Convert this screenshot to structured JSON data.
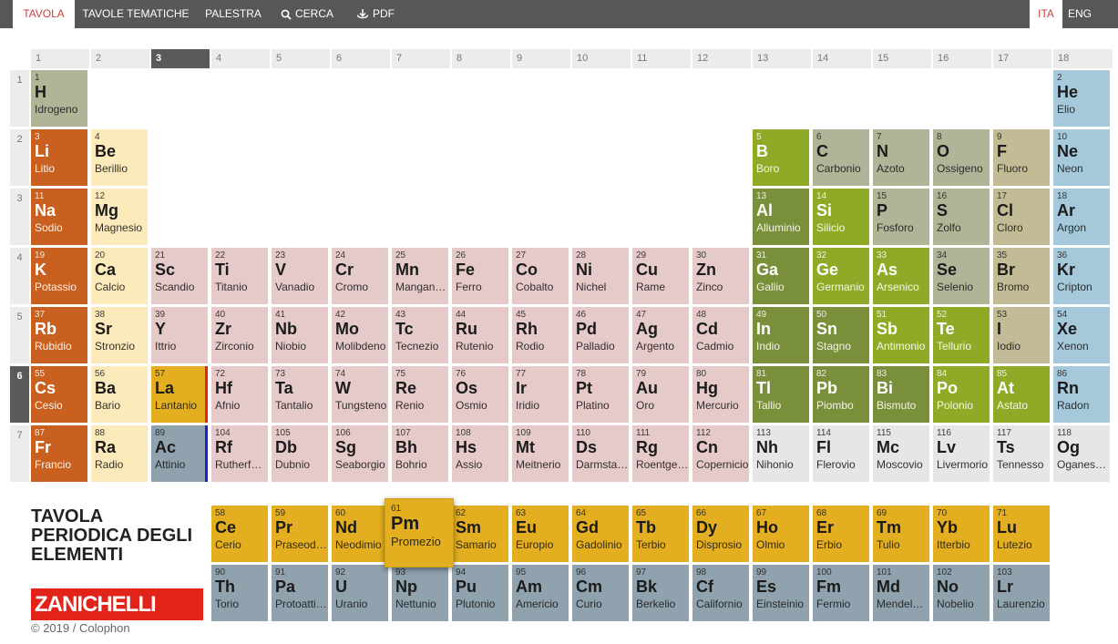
{
  "nav": {
    "left": [
      {
        "label": "TAVOLA",
        "icon": null,
        "active": true
      },
      {
        "label": "TAVOLE TEMATICHE",
        "icon": null,
        "active": false
      },
      {
        "label": "PALESTRA",
        "icon": null,
        "active": false
      },
      {
        "label": "CERCA",
        "icon": "search-icon",
        "active": false
      },
      {
        "label": "PDF",
        "icon": "download-icon",
        "active": false
      }
    ],
    "right": [
      {
        "label": "ITA",
        "active": true
      },
      {
        "label": "ENG",
        "active": false
      }
    ]
  },
  "groups": [
    "1",
    "2",
    "3",
    "4",
    "5",
    "6",
    "7",
    "8",
    "9",
    "10",
    "11",
    "12",
    "13",
    "14",
    "15",
    "16",
    "17",
    "18"
  ],
  "selected_group": "3",
  "periods": [
    "1",
    "2",
    "3",
    "4",
    "5",
    "6",
    "7"
  ],
  "selected_period": "6",
  "title_lines": [
    "TAVOLA",
    "PERIODICA DEGLI",
    "ELEMENTI"
  ],
  "brand": "ZANICHELLI",
  "footer": {
    "copyright": "© 2019 /",
    "colophon": "Colophon"
  },
  "colors": {
    "alkali": "#c9601f",
    "alkaline_earth": "#fdeabb",
    "transition": "#e6caca",
    "post_transition": "#7a8f3a",
    "metalloid": "#8faa27",
    "nonmetal": "#b2b498",
    "halogen": "#c3bb95",
    "noble_gas": "#a5c9da",
    "lanthanide": "#e3ae1f",
    "actinide": "#8fa2ae",
    "unknown": "#e6e6e6",
    "lanthanide_marker": "#e2231a",
    "actinide_marker": "#2020c8"
  },
  "elements": [
    {
      "n": "1",
      "s": "H",
      "name": "Idrogeno",
      "row": 1,
      "col": 1,
      "cat": "nonmetal"
    },
    {
      "n": "2",
      "s": "He",
      "name": "Elio",
      "row": 1,
      "col": 18,
      "cat": "noble_gas"
    },
    {
      "n": "3",
      "s": "Li",
      "name": "Litio",
      "row": 2,
      "col": 1,
      "cat": "alkali"
    },
    {
      "n": "4",
      "s": "Be",
      "name": "Berillio",
      "row": 2,
      "col": 2,
      "cat": "alkaline_earth"
    },
    {
      "n": "5",
      "s": "B",
      "name": "Boro",
      "row": 2,
      "col": 13,
      "cat": "metalloid"
    },
    {
      "n": "6",
      "s": "C",
      "name": "Carbonio",
      "row": 2,
      "col": 14,
      "cat": "nonmetal"
    },
    {
      "n": "7",
      "s": "N",
      "name": "Azoto",
      "row": 2,
      "col": 15,
      "cat": "nonmetal"
    },
    {
      "n": "8",
      "s": "O",
      "name": "Ossigeno",
      "row": 2,
      "col": 16,
      "cat": "nonmetal"
    },
    {
      "n": "9",
      "s": "F",
      "name": "Fluoro",
      "row": 2,
      "col": 17,
      "cat": "halogen"
    },
    {
      "n": "10",
      "s": "Ne",
      "name": "Neon",
      "row": 2,
      "col": 18,
      "cat": "noble_gas"
    },
    {
      "n": "11",
      "s": "Na",
      "name": "Sodio",
      "row": 3,
      "col": 1,
      "cat": "alkali"
    },
    {
      "n": "12",
      "s": "Mg",
      "name": "Magnesio",
      "row": 3,
      "col": 2,
      "cat": "alkaline_earth"
    },
    {
      "n": "13",
      "s": "Al",
      "name": "Alluminio",
      "row": 3,
      "col": 13,
      "cat": "post_transition"
    },
    {
      "n": "14",
      "s": "Si",
      "name": "Silicio",
      "row": 3,
      "col": 14,
      "cat": "metalloid"
    },
    {
      "n": "15",
      "s": "P",
      "name": "Fosforo",
      "row": 3,
      "col": 15,
      "cat": "nonmetal"
    },
    {
      "n": "16",
      "s": "S",
      "name": "Zolfo",
      "row": 3,
      "col": 16,
      "cat": "nonmetal"
    },
    {
      "n": "17",
      "s": "Cl",
      "name": "Cloro",
      "row": 3,
      "col": 17,
      "cat": "halogen"
    },
    {
      "n": "18",
      "s": "Ar",
      "name": "Argon",
      "row": 3,
      "col": 18,
      "cat": "noble_gas"
    },
    {
      "n": "19",
      "s": "K",
      "name": "Potassio",
      "row": 4,
      "col": 1,
      "cat": "alkali"
    },
    {
      "n": "20",
      "s": "Ca",
      "name": "Calcio",
      "row": 4,
      "col": 2,
      "cat": "alkaline_earth"
    },
    {
      "n": "21",
      "s": "Sc",
      "name": "Scandio",
      "row": 4,
      "col": 3,
      "cat": "transition"
    },
    {
      "n": "22",
      "s": "Ti",
      "name": "Titanio",
      "row": 4,
      "col": 4,
      "cat": "transition"
    },
    {
      "n": "23",
      "s": "V",
      "name": "Vanadio",
      "row": 4,
      "col": 5,
      "cat": "transition"
    },
    {
      "n": "24",
      "s": "Cr",
      "name": "Cromo",
      "row": 4,
      "col": 6,
      "cat": "transition"
    },
    {
      "n": "25",
      "s": "Mn",
      "name": "Manganese",
      "row": 4,
      "col": 7,
      "cat": "transition"
    },
    {
      "n": "26",
      "s": "Fe",
      "name": "Ferro",
      "row": 4,
      "col": 8,
      "cat": "transition"
    },
    {
      "n": "27",
      "s": "Co",
      "name": "Cobalto",
      "row": 4,
      "col": 9,
      "cat": "transition"
    },
    {
      "n": "28",
      "s": "Ni",
      "name": "Nichel",
      "row": 4,
      "col": 10,
      "cat": "transition"
    },
    {
      "n": "29",
      "s": "Cu",
      "name": "Rame",
      "row": 4,
      "col": 11,
      "cat": "transition"
    },
    {
      "n": "30",
      "s": "Zn",
      "name": "Zinco",
      "row": 4,
      "col": 12,
      "cat": "transition"
    },
    {
      "n": "31",
      "s": "Ga",
      "name": "Gallio",
      "row": 4,
      "col": 13,
      "cat": "post_transition"
    },
    {
      "n": "32",
      "s": "Ge",
      "name": "Germanio",
      "row": 4,
      "col": 14,
      "cat": "metalloid"
    },
    {
      "n": "33",
      "s": "As",
      "name": "Arsenico",
      "row": 4,
      "col": 15,
      "cat": "metalloid"
    },
    {
      "n": "34",
      "s": "Se",
      "name": "Selenio",
      "row": 4,
      "col": 16,
      "cat": "nonmetal"
    },
    {
      "n": "35",
      "s": "Br",
      "name": "Bromo",
      "row": 4,
      "col": 17,
      "cat": "halogen"
    },
    {
      "n": "36",
      "s": "Kr",
      "name": "Cripton",
      "row": 4,
      "col": 18,
      "cat": "noble_gas"
    },
    {
      "n": "37",
      "s": "Rb",
      "name": "Rubidio",
      "row": 5,
      "col": 1,
      "cat": "alkali"
    },
    {
      "n": "38",
      "s": "Sr",
      "name": "Stronzio",
      "row": 5,
      "col": 2,
      "cat": "alkaline_earth"
    },
    {
      "n": "39",
      "s": "Y",
      "name": "Ittrio",
      "row": 5,
      "col": 3,
      "cat": "transition"
    },
    {
      "n": "40",
      "s": "Zr",
      "name": "Zirconio",
      "row": 5,
      "col": 4,
      "cat": "transition"
    },
    {
      "n": "41",
      "s": "Nb",
      "name": "Niobio",
      "row": 5,
      "col": 5,
      "cat": "transition"
    },
    {
      "n": "42",
      "s": "Mo",
      "name": "Molibdeno",
      "row": 5,
      "col": 6,
      "cat": "transition"
    },
    {
      "n": "43",
      "s": "Tc",
      "name": "Tecnezio",
      "row": 5,
      "col": 7,
      "cat": "transition"
    },
    {
      "n": "44",
      "s": "Ru",
      "name": "Rutenio",
      "row": 5,
      "col": 8,
      "cat": "transition"
    },
    {
      "n": "45",
      "s": "Rh",
      "name": "Rodio",
      "row": 5,
      "col": 9,
      "cat": "transition"
    },
    {
      "n": "46",
      "s": "Pd",
      "name": "Palladio",
      "row": 5,
      "col": 10,
      "cat": "transition"
    },
    {
      "n": "47",
      "s": "Ag",
      "name": "Argento",
      "row": 5,
      "col": 11,
      "cat": "transition"
    },
    {
      "n": "48",
      "s": "Cd",
      "name": "Cadmio",
      "row": 5,
      "col": 12,
      "cat": "transition"
    },
    {
      "n": "49",
      "s": "In",
      "name": "Indio",
      "row": 5,
      "col": 13,
      "cat": "post_transition"
    },
    {
      "n": "50",
      "s": "Sn",
      "name": "Stagno",
      "row": 5,
      "col": 14,
      "cat": "post_transition"
    },
    {
      "n": "51",
      "s": "Sb",
      "name": "Antimonio",
      "row": 5,
      "col": 15,
      "cat": "metalloid"
    },
    {
      "n": "52",
      "s": "Te",
      "name": "Tellurio",
      "row": 5,
      "col": 16,
      "cat": "metalloid"
    },
    {
      "n": "53",
      "s": "I",
      "name": "Iodio",
      "row": 5,
      "col": 17,
      "cat": "halogen"
    },
    {
      "n": "54",
      "s": "Xe",
      "name": "Xenon",
      "row": 5,
      "col": 18,
      "cat": "noble_gas"
    },
    {
      "n": "55",
      "s": "Cs",
      "name": "Cesio",
      "row": 6,
      "col": 1,
      "cat": "alkali"
    },
    {
      "n": "56",
      "s": "Ba",
      "name": "Bario",
      "row": 6,
      "col": 2,
      "cat": "alkaline_earth"
    },
    {
      "n": "57",
      "s": "La",
      "name": "Lantanio",
      "row": 6,
      "col": 3,
      "cat": "lanthanide"
    },
    {
      "n": "72",
      "s": "Hf",
      "name": "Afnio",
      "row": 6,
      "col": 4,
      "cat": "transition"
    },
    {
      "n": "73",
      "s": "Ta",
      "name": "Tantalio",
      "row": 6,
      "col": 5,
      "cat": "transition"
    },
    {
      "n": "74",
      "s": "W",
      "name": "Tungsteno",
      "row": 6,
      "col": 6,
      "cat": "transition"
    },
    {
      "n": "75",
      "s": "Re",
      "name": "Renio",
      "row": 6,
      "col": 7,
      "cat": "transition"
    },
    {
      "n": "76",
      "s": "Os",
      "name": "Osmio",
      "row": 6,
      "col": 8,
      "cat": "transition"
    },
    {
      "n": "77",
      "s": "Ir",
      "name": "Iridio",
      "row": 6,
      "col": 9,
      "cat": "transition"
    },
    {
      "n": "78",
      "s": "Pt",
      "name": "Platino",
      "row": 6,
      "col": 10,
      "cat": "transition"
    },
    {
      "n": "79",
      "s": "Au",
      "name": "Oro",
      "row": 6,
      "col": 11,
      "cat": "transition"
    },
    {
      "n": "80",
      "s": "Hg",
      "name": "Mercurio",
      "row": 6,
      "col": 12,
      "cat": "transition"
    },
    {
      "n": "81",
      "s": "Tl",
      "name": "Tallio",
      "row": 6,
      "col": 13,
      "cat": "post_transition"
    },
    {
      "n": "82",
      "s": "Pb",
      "name": "Piombo",
      "row": 6,
      "col": 14,
      "cat": "post_transition"
    },
    {
      "n": "83",
      "s": "Bi",
      "name": "Bismuto",
      "row": 6,
      "col": 15,
      "cat": "post_transition"
    },
    {
      "n": "84",
      "s": "Po",
      "name": "Polonio",
      "row": 6,
      "col": 16,
      "cat": "metalloid"
    },
    {
      "n": "85",
      "s": "At",
      "name": "Astato",
      "row": 6,
      "col": 17,
      "cat": "metalloid"
    },
    {
      "n": "86",
      "s": "Rn",
      "name": "Radon",
      "row": 6,
      "col": 18,
      "cat": "noble_gas"
    },
    {
      "n": "87",
      "s": "Fr",
      "name": "Francio",
      "row": 7,
      "col": 1,
      "cat": "alkali"
    },
    {
      "n": "88",
      "s": "Ra",
      "name": "Radio",
      "row": 7,
      "col": 2,
      "cat": "alkaline_earth"
    },
    {
      "n": "89",
      "s": "Ac",
      "name": "Attinio",
      "row": 7,
      "col": 3,
      "cat": "actinide"
    },
    {
      "n": "104",
      "s": "Rf",
      "name": "Rutherfordio",
      "row": 7,
      "col": 4,
      "cat": "transition"
    },
    {
      "n": "105",
      "s": "Db",
      "name": "Dubnio",
      "row": 7,
      "col": 5,
      "cat": "transition"
    },
    {
      "n": "106",
      "s": "Sg",
      "name": "Seaborgio",
      "row": 7,
      "col": 6,
      "cat": "transition"
    },
    {
      "n": "107",
      "s": "Bh",
      "name": "Bohrio",
      "row": 7,
      "col": 7,
      "cat": "transition"
    },
    {
      "n": "108",
      "s": "Hs",
      "name": "Assio",
      "row": 7,
      "col": 8,
      "cat": "transition"
    },
    {
      "n": "109",
      "s": "Mt",
      "name": "Meitnerio",
      "row": 7,
      "col": 9,
      "cat": "transition"
    },
    {
      "n": "110",
      "s": "Ds",
      "name": "Darmstadtio",
      "row": 7,
      "col": 10,
      "cat": "transition"
    },
    {
      "n": "111",
      "s": "Rg",
      "name": "Roentgenio",
      "row": 7,
      "col": 11,
      "cat": "transition"
    },
    {
      "n": "112",
      "s": "Cn",
      "name": "Copernicio",
      "row": 7,
      "col": 12,
      "cat": "transition"
    },
    {
      "n": "113",
      "s": "Nh",
      "name": "Nihonio",
      "row": 7,
      "col": 13,
      "cat": "unknown"
    },
    {
      "n": "114",
      "s": "Fl",
      "name": "Flerovio",
      "row": 7,
      "col": 14,
      "cat": "unknown"
    },
    {
      "n": "115",
      "s": "Mc",
      "name": "Moscovio",
      "row": 7,
      "col": 15,
      "cat": "unknown"
    },
    {
      "n": "116",
      "s": "Lv",
      "name": "Livermorio",
      "row": 7,
      "col": 16,
      "cat": "unknown"
    },
    {
      "n": "117",
      "s": "Ts",
      "name": "Tennesso",
      "row": 7,
      "col": 17,
      "cat": "unknown"
    },
    {
      "n": "118",
      "s": "Og",
      "name": "Oganesson",
      "row": 7,
      "col": 18,
      "cat": "unknown"
    },
    {
      "n": "58",
      "s": "Ce",
      "name": "Cerio",
      "row": 8,
      "col": 4,
      "cat": "lanthanide"
    },
    {
      "n": "59",
      "s": "Pr",
      "name": "Praseodimio",
      "row": 8,
      "col": 5,
      "cat": "lanthanide"
    },
    {
      "n": "60",
      "s": "Nd",
      "name": "Neodimio",
      "row": 8,
      "col": 6,
      "cat": "lanthanide"
    },
    {
      "n": "61",
      "s": "Pm",
      "name": "Promezio",
      "row": 8,
      "col": 7,
      "cat": "lanthanide",
      "selected": true
    },
    {
      "n": "62",
      "s": "Sm",
      "name": "Samario",
      "row": 8,
      "col": 8,
      "cat": "lanthanide"
    },
    {
      "n": "63",
      "s": "Eu",
      "name": "Europio",
      "row": 8,
      "col": 9,
      "cat": "lanthanide"
    },
    {
      "n": "64",
      "s": "Gd",
      "name": "Gadolinio",
      "row": 8,
      "col": 10,
      "cat": "lanthanide"
    },
    {
      "n": "65",
      "s": "Tb",
      "name": "Terbio",
      "row": 8,
      "col": 11,
      "cat": "lanthanide"
    },
    {
      "n": "66",
      "s": "Dy",
      "name": "Disprosio",
      "row": 8,
      "col": 12,
      "cat": "lanthanide"
    },
    {
      "n": "67",
      "s": "Ho",
      "name": "Olmio",
      "row": 8,
      "col": 13,
      "cat": "lanthanide"
    },
    {
      "n": "68",
      "s": "Er",
      "name": "Erbio",
      "row": 8,
      "col": 14,
      "cat": "lanthanide"
    },
    {
      "n": "69",
      "s": "Tm",
      "name": "Tulio",
      "row": 8,
      "col": 15,
      "cat": "lanthanide"
    },
    {
      "n": "70",
      "s": "Yb",
      "name": "Itterbio",
      "row": 8,
      "col": 16,
      "cat": "lanthanide"
    },
    {
      "n": "71",
      "s": "Lu",
      "name": "Lutezio",
      "row": 8,
      "col": 17,
      "cat": "lanthanide"
    },
    {
      "n": "90",
      "s": "Th",
      "name": "Torio",
      "row": 9,
      "col": 4,
      "cat": "actinide"
    },
    {
      "n": "91",
      "s": "Pa",
      "name": "Protoattinio",
      "row": 9,
      "col": 5,
      "cat": "actinide"
    },
    {
      "n": "92",
      "s": "U",
      "name": "Uranio",
      "row": 9,
      "col": 6,
      "cat": "actinide"
    },
    {
      "n": "93",
      "s": "Np",
      "name": "Nettunio",
      "row": 9,
      "col": 7,
      "cat": "actinide"
    },
    {
      "n": "94",
      "s": "Pu",
      "name": "Plutonio",
      "row": 9,
      "col": 8,
      "cat": "actinide"
    },
    {
      "n": "95",
      "s": "Am",
      "name": "Americio",
      "row": 9,
      "col": 9,
      "cat": "actinide"
    },
    {
      "n": "96",
      "s": "Cm",
      "name": "Curio",
      "row": 9,
      "col": 10,
      "cat": "actinide"
    },
    {
      "n": "97",
      "s": "Bk",
      "name": "Berkelio",
      "row": 9,
      "col": 11,
      "cat": "actinide"
    },
    {
      "n": "98",
      "s": "Cf",
      "name": "Californio",
      "row": 9,
      "col": 12,
      "cat": "actinide"
    },
    {
      "n": "99",
      "s": "Es",
      "name": "Einsteinio",
      "row": 9,
      "col": 13,
      "cat": "actinide"
    },
    {
      "n": "100",
      "s": "Fm",
      "name": "Fermio",
      "row": 9,
      "col": 14,
      "cat": "actinide"
    },
    {
      "n": "101",
      "s": "Md",
      "name": "Mendelevio",
      "row": 9,
      "col": 15,
      "cat": "actinide"
    },
    {
      "n": "102",
      "s": "No",
      "name": "Nobelio",
      "row": 9,
      "col": 16,
      "cat": "actinide"
    },
    {
      "n": "103",
      "s": "Lr",
      "name": "Laurenzio",
      "row": 9,
      "col": 17,
      "cat": "actinide"
    }
  ]
}
